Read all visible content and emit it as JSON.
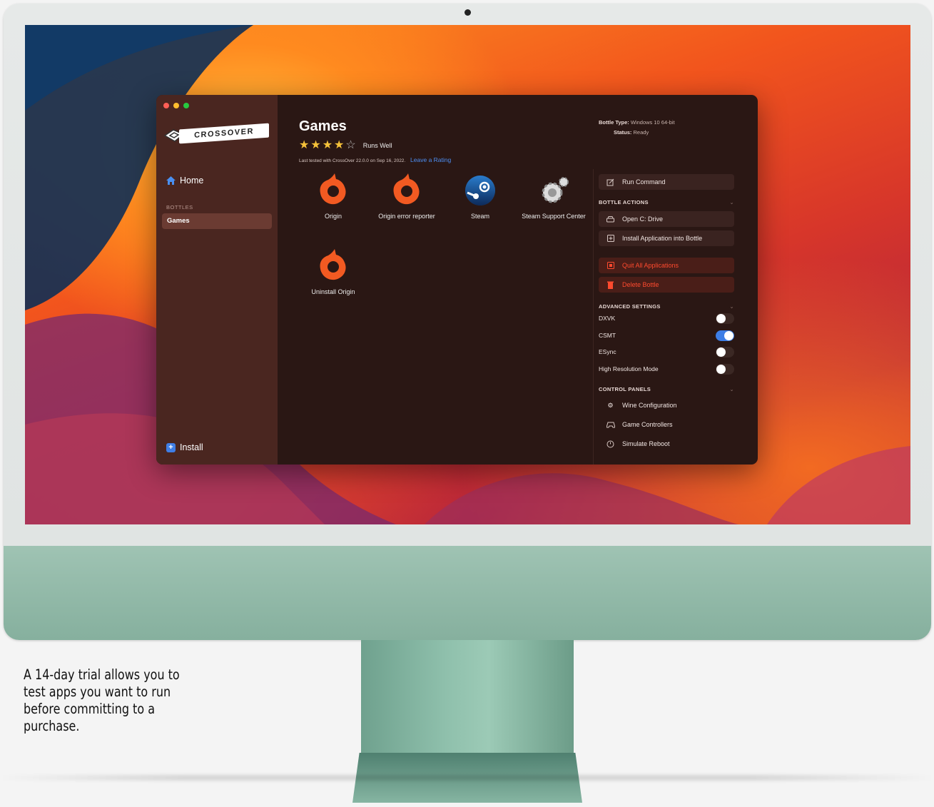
{
  "window": {
    "app_name": "CROSSOVER",
    "sidebar": {
      "home_label": "Home",
      "bottles_section": "BOTTLES",
      "bottles": [
        "Games"
      ],
      "install_label": "Install"
    },
    "header": {
      "title": "Games",
      "rating": {
        "stars": 4,
        "max": 5,
        "label": "Runs Well"
      },
      "tested_text": "Last tested with CrossOver 22.0.0 on Sep 16, 2022.",
      "rate_link": "Leave a Rating",
      "bottle_type_label": "Bottle Type:",
      "bottle_type_value": "Windows 10 64-bit",
      "status_label": "Status:",
      "status_value": "Ready"
    },
    "apps": [
      {
        "name": "Origin",
        "icon": "origin-icon"
      },
      {
        "name": "Origin error reporter",
        "icon": "origin-icon"
      },
      {
        "name": "Steam",
        "icon": "steam-icon"
      },
      {
        "name": "Steam Support Center",
        "icon": "gear-cluster-icon"
      },
      {
        "name": "Uninstall Origin",
        "icon": "origin-icon"
      }
    ],
    "panel": {
      "run_command": "Run Command",
      "bottle_actions_title": "BOTTLE ACTIONS",
      "open_c_drive": "Open C: Drive",
      "install_into_bottle": "Install Application into Bottle",
      "quit_all": "Quit All Applications",
      "delete_bottle": "Delete Bottle",
      "advanced_title": "ADVANCED SETTINGS",
      "toggles": [
        {
          "label": "DXVK",
          "on": false
        },
        {
          "label": "CSMT",
          "on": true
        },
        {
          "label": "ESync",
          "on": false
        },
        {
          "label": "High Resolution Mode",
          "on": false
        }
      ],
      "control_panels_title": "CONTROL PANELS",
      "wine_config": "Wine Configuration",
      "game_controllers": "Game Controllers",
      "simulate_reboot": "Simulate Reboot"
    },
    "colors": {
      "accent": "#3d7ee6",
      "danger": "#ff4a2e",
      "star": "#f6c23a"
    }
  },
  "caption": "A 14-day trial allows you to test apps you want to run before committing to a purchase."
}
